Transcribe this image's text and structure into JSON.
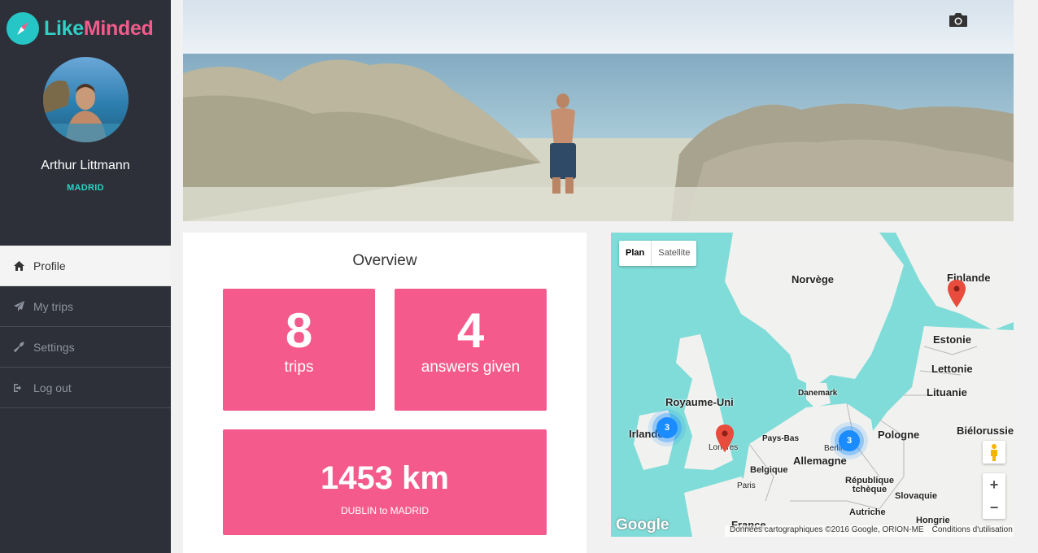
{
  "brand": {
    "like": "Like",
    "minded": "Minded"
  },
  "user": {
    "name": "Arthur Littmann",
    "city": "MADRID"
  },
  "nav": [
    {
      "label": "Profile",
      "icon": "home-icon",
      "active": true
    },
    {
      "label": "My trips",
      "icon": "paper-plane-icon",
      "active": false
    },
    {
      "label": "Settings",
      "icon": "wrench-icon",
      "active": false
    },
    {
      "label": "Log out",
      "icon": "sign-out-icon",
      "active": false
    }
  ],
  "overview": {
    "title": "Overview",
    "trips": {
      "value": "8",
      "label": "trips"
    },
    "answers": {
      "value": "4",
      "label": "answers given"
    },
    "distance": {
      "value": "1453 km",
      "label": "DUBLIN to MADRID"
    }
  },
  "map": {
    "type_plan": "Plan",
    "type_satellite": "Satellite",
    "labels": {
      "norway": "Norvège",
      "finland": "Finlande",
      "estonia": "Estonie",
      "latvia": "Lettonie",
      "lithuania": "Lituanie",
      "belarus": "Biélorussie",
      "uk": "Royaume-Uni",
      "ireland": "Irlande",
      "denmark": "Danemark",
      "poland": "Pologne",
      "netherlands": "Pays-Bas",
      "germany": "Allemagne",
      "belgium": "Belgique",
      "czech": "République tchèque",
      "slovakia": "Slovaquie",
      "austria": "Autriche",
      "hungary": "Hongrie",
      "france": "France",
      "london": "Londres",
      "berlin": "Berlin",
      "paris": "Paris"
    },
    "cluster_ireland": "3",
    "cluster_berlin": "3",
    "zoom_in": "+",
    "zoom_out": "−",
    "google": "Google",
    "attribution": "Données cartographiques ©2016 Google, ORION-ME",
    "terms": "Conditions d'utilisation"
  },
  "colors": {
    "sidebar": "#2d3038",
    "accent_pink": "#f45b8c",
    "accent_teal": "#2fd0c6"
  }
}
